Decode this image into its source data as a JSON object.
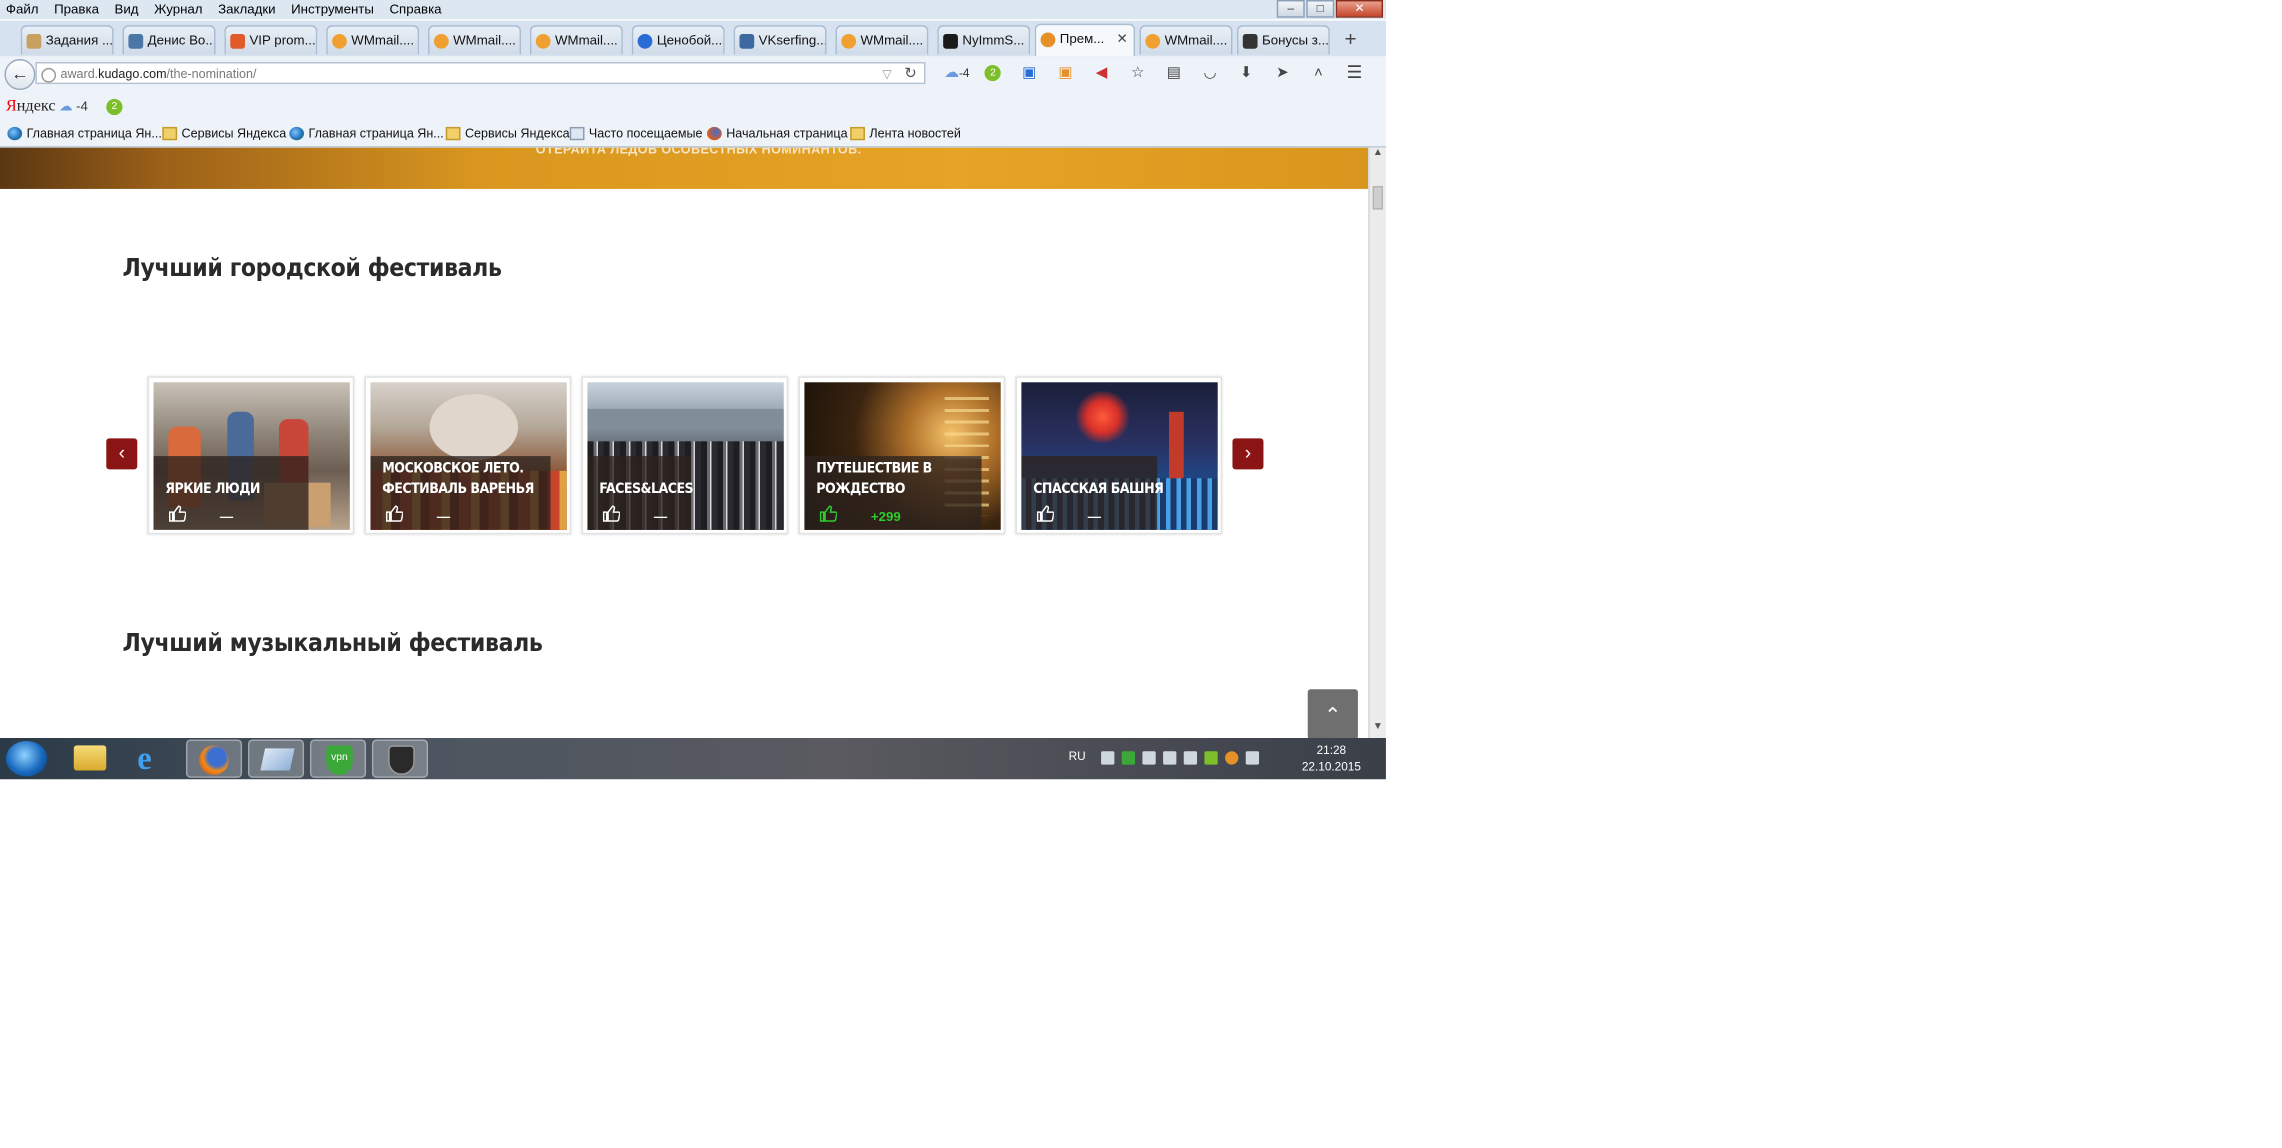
{
  "menu": [
    "Файл",
    "Правка",
    "Вид",
    "Журнал",
    "Закладки",
    "Инструменты",
    "Справка"
  ],
  "window_controls": {
    "minimize": "–",
    "maximize": "□",
    "close": "✕"
  },
  "tabs": [
    {
      "label": "Задания ...",
      "icon_color": "#c8a060"
    },
    {
      "label": "Денис Во...",
      "icon_color": "#4a76a8"
    },
    {
      "label": "VIP prom...",
      "icon_color": "#e05a2a"
    },
    {
      "label": "WMmail....",
      "icon_color": "#f0a030"
    },
    {
      "label": "WMmail....",
      "icon_color": "#f0a030"
    },
    {
      "label": "WMmail....",
      "icon_color": "#f0a030"
    },
    {
      "label": "Ценобой...",
      "icon_color": "#2a6bd6"
    },
    {
      "label": "VKserfing...",
      "icon_color": "#3c6aa0"
    },
    {
      "label": "WMmail....",
      "icon_color": "#f0a030"
    },
    {
      "label": "NyImmS...",
      "icon_color": "#1a1a1a"
    },
    {
      "label": "Прем...",
      "icon_color": "#e6902a",
      "active": true,
      "close": "✕"
    },
    {
      "label": "WMmail....",
      "icon_color": "#f0a030"
    },
    {
      "label": "Бонусы з...",
      "icon_color": "#333333"
    }
  ],
  "new_tab": "+",
  "nav": {
    "back": "←",
    "url_host": "award.",
    "url_domain": "kudago.com",
    "url_path": "/the-nomination/",
    "dropdown": "▽",
    "reload": "↻",
    "weather": "-4",
    "badge": "2"
  },
  "yandex": {
    "logo_first": "Я",
    "logo_rest": "ндекс",
    "weather": "-4",
    "badge": "2"
  },
  "bookmarks": [
    {
      "label": "Главная страница Ян...",
      "icon": "globe"
    },
    {
      "label": "Сервисы Яндекса",
      "icon": "folder"
    },
    {
      "label": "Главная страница Ян...",
      "icon": "globe"
    },
    {
      "label": "Сервисы Яндекса",
      "icon": "folder"
    },
    {
      "label": "Часто посещаемые",
      "icon": "page"
    },
    {
      "label": "Начальная страница",
      "icon": "fox"
    },
    {
      "label": "Лента новостей",
      "icon": "rss"
    }
  ],
  "page": {
    "banner_text": "ОТЕРАИТА ЛЕДОВ ОСОВЕСТНЫХ НОМИНАНТОВ.",
    "section1_title": "Лучший городской фестиваль",
    "section2_title": "Лучший музыкальный фестиваль",
    "arrow_prev": "‹",
    "arrow_next": "›",
    "to_top": "⌃",
    "cards": [
      {
        "title": "Яркие люди",
        "score": "—",
        "positive": false,
        "colors": [
          "#7a6a5e",
          "#b8a48e",
          "#d86a3c"
        ]
      },
      {
        "title": "Московское лето. Фестиваль варенья",
        "score": "—",
        "positive": false,
        "colors": [
          "#9a6a4c",
          "#d8cfc4",
          "#7a3a1c"
        ]
      },
      {
        "title": "Faces&Laces",
        "score": "—",
        "positive": false,
        "colors": [
          "#8a9aa6",
          "#c9ccd0",
          "#3b3e44"
        ]
      },
      {
        "title": "Путешествие в Рождество",
        "score": "+299",
        "positive": true,
        "colors": [
          "#1a140c",
          "#d6a048",
          "#3a2410"
        ]
      },
      {
        "title": "Спасская башня",
        "score": "—",
        "positive": false,
        "colors": [
          "#1d2a55",
          "#c23a2a",
          "#2a6fb5"
        ]
      }
    ]
  },
  "taskbar": {
    "lang": "RU",
    "time": "21:28",
    "date": "22.10.2015",
    "vpn_label": "vpn"
  }
}
